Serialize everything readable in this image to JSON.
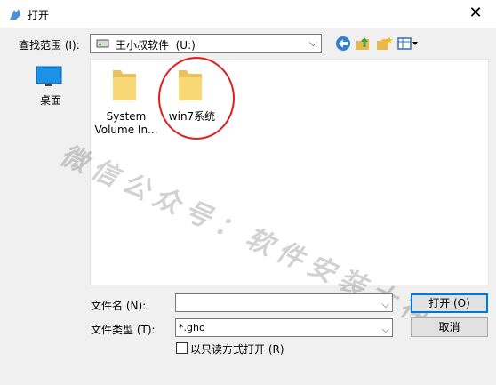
{
  "window": {
    "title": "打开",
    "close_glyph": "✕"
  },
  "toolbar": {
    "lookin_label": "查找范围 (I):",
    "lookin_value": "王小叔软件  (U:)",
    "back_icon": "back-arrow-icon",
    "up_icon": "up-folder-icon",
    "newfolder_icon": "new-folder-icon",
    "views_icon": "view-menu-icon"
  },
  "places": [
    {
      "label": "桌面",
      "icon": "desktop-icon"
    }
  ],
  "files": [
    {
      "label": "System Volume In...",
      "line1": "System",
      "line2": "Volume In...",
      "icon": "folder-icon"
    },
    {
      "label": "win7系统",
      "line1": "win7系统",
      "line2": "",
      "icon": "folder-icon"
    }
  ],
  "annotation": {
    "highlight_color": "#e02020"
  },
  "watermark": {
    "text": "微信公众号：软件安装大神"
  },
  "form": {
    "filename_label": "文件名 (N):",
    "filename_value": "",
    "filetype_label": "文件类型 (T):",
    "filetype_value": "*.gho",
    "readonly_label": "以只读方式打开 (R)",
    "readonly_checked": false
  },
  "buttons": {
    "open_label": "打开 (O)",
    "cancel_label": "取消"
  },
  "colors": {
    "accent": "#0078d7",
    "dialog_bg": "#f0f0f0",
    "folder_yellow": "#f8d775"
  }
}
